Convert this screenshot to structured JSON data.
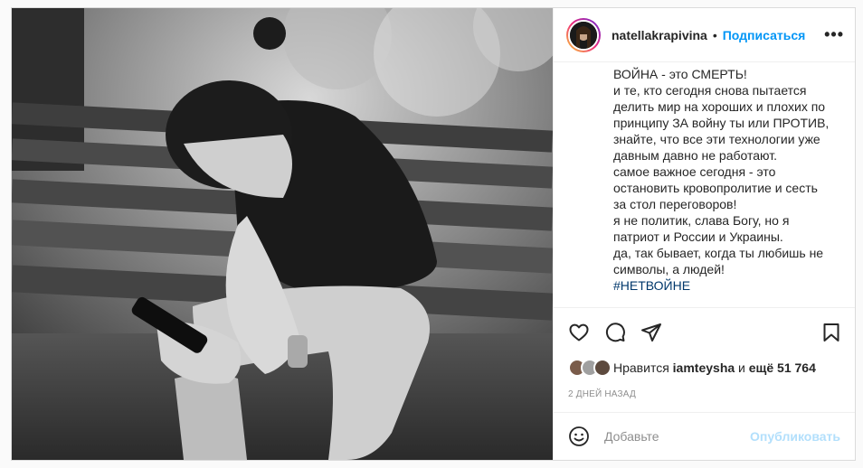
{
  "post": {
    "username": "natellakrapivina",
    "separator": "•",
    "follow_label": "Подписаться",
    "more_label": "•••",
    "caption_lines": [
      "ВОЙНА - это СМЕРТЬ!",
      "и те, кто сегодня снова пытается",
      "делить мир на хороших и плохих по",
      "принципу ЗА войну ты или ПРОТИВ,",
      "знайте, что все эти технологии уже",
      "давным давно не работают.",
      "самое важное сегодня - это",
      "остановить кровопролитие и сесть",
      "за стол переговоров!",
      "я не политик, слава Богу, но я",
      "патриот и России и Украины.",
      "да, так бывает, когда ты любишь не",
      "символы, а людей!"
    ],
    "hashtag": "#НЕТВОЙНЕ",
    "likes": {
      "prefix": "Нравится",
      "user": "iamteysha",
      "middle": "и",
      "rest": "ещё 51 764"
    },
    "timestamp": "2 ДНЕЙ НАЗАД",
    "comment_placeholder": "Добавьте",
    "publish_label": "Опубликовать"
  },
  "icons": [
    "heart-icon",
    "comment-icon",
    "share-icon",
    "bookmark-icon",
    "emoji-icon",
    "more-icon"
  ],
  "colors": {
    "accent": "#0095f6",
    "hashtag": "#00376b",
    "publish_disabled": "#b2dffc",
    "muted": "#8e8e8e"
  }
}
